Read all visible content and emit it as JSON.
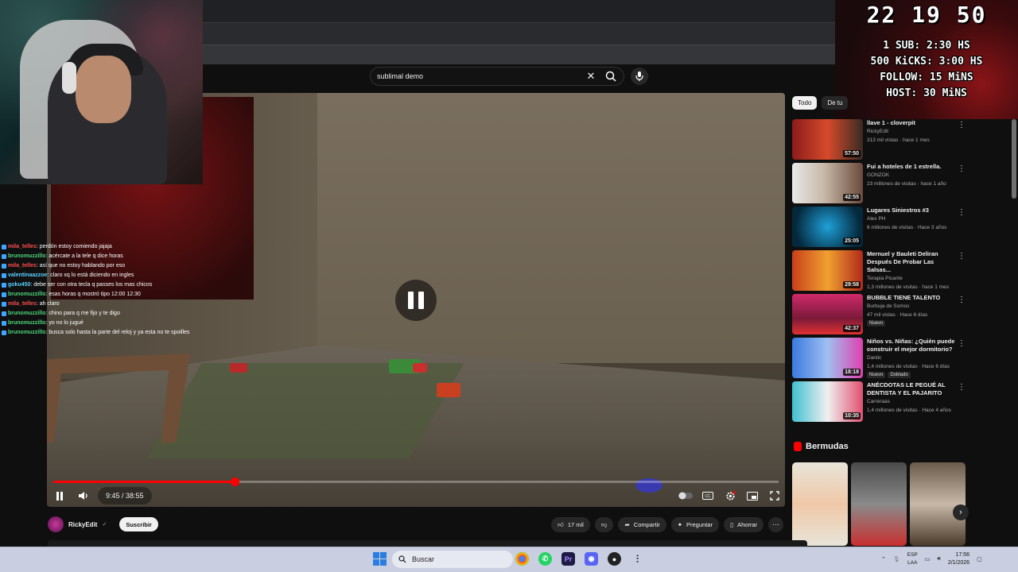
{
  "search": {
    "query": "sublimal demo"
  },
  "overlay": {
    "clock": "22 19 50",
    "goals": [
      "1 SUB: 2:30 HS",
      "500 KiCKS: 3:00 HS",
      "FOLLOW: 15 MiNS",
      "HOST: 30 MiNS"
    ]
  },
  "player": {
    "time": "9:45 / 38:55",
    "progress_fraction": 0.2505
  },
  "chat": [
    {
      "user": "mila_telles",
      "msg": ": perdón estoy comiendo jajaja",
      "color": "#ff4d4d"
    },
    {
      "user": "brunomuzzillo",
      "msg": ": acércate a la tele q dice horas",
      "color": "#4dd47a"
    },
    {
      "user": "mila_telles",
      "msg": ": así que no estoy hablando por eso",
      "color": "#ff4d4d"
    },
    {
      "user": "valentinaazzoe",
      "msg": ": claro xq lo está diciendo en ingles",
      "color": "#5ad1ff"
    },
    {
      "user": "goku450",
      "msg": ": debe ser con otra tecla q passes los mas chicos",
      "color": "#5ad1ff"
    },
    {
      "user": "brunomuzzillo",
      "msg": ": esas horas q mostró tipo 12:00 12:30",
      "color": "#4dd47a"
    },
    {
      "user": "mila_telles",
      "msg": ": ah claro",
      "color": "#ff4d4d"
    },
    {
      "user": "brunomuzzillo",
      "msg": ": chino para q me fijo y te digo",
      "color": "#4dd47a"
    },
    {
      "user": "brunomuzzillo",
      "msg": ": yo no lo jugué",
      "color": "#4dd47a"
    },
    {
      "user": "brunomuzzillo",
      "msg": ": busca solo hasta la parte del reloj y ya esta no te spoilles",
      "color": "#4dd47a"
    }
  ],
  "chips": [
    "Todo",
    "De tu"
  ],
  "recommendations": [
    {
      "title": "llave 1 - cloverpit",
      "channel": "RickyEdit",
      "meta": "313 mil vistas · hace 1 mes",
      "duration": "57:50",
      "badges": [],
      "thumb": "linear-gradient(90deg,#8a1b1b,#d64a2a 50%,#3a2a22)"
    },
    {
      "title": "Fui a hoteles de 1 estrella.",
      "channel": "GONZOK",
      "meta": "23 millones de visitas · hace 1 año",
      "duration": "42:55",
      "badges": [],
      "thumb": "linear-gradient(90deg,#e8e8e8,#c8b8a8 45%,#6a4a3a)"
    },
    {
      "title": "Lugares Siniestros #3",
      "channel": "Alex PH",
      "meta": "6 millones de visitas · Hace 3 años",
      "duration": "25:05",
      "badges": [],
      "thumb": "radial-gradient(circle at 50% 50%,#1fa0d8,#04283c 80%)"
    },
    {
      "title": "Mernuel y Bauleti Deliran Después De Probar Las Salsas...",
      "channel": "Terapia Picante",
      "meta": "1,3 millones de visitas · hace 1 mes",
      "duration": "29:58",
      "badges": [],
      "thumb": "linear-gradient(90deg,#c8401a,#f0a030 50%,#b02a1a)"
    },
    {
      "title": "BUBBLE TIENE TALENTO",
      "channel": "Burbuja de Somos",
      "meta": "47 mil vistas · Hace 6 días",
      "duration": "42:37",
      "badges": [
        "Nuevo"
      ],
      "thumb": "linear-gradient(180deg,#d02a6a,#7a1a3a 60%,#e03030)"
    },
    {
      "title": "Niños vs. Niñas: ¿Quién puede construir el mejor dormitorio?",
      "channel": "Dantic",
      "meta": "1,4 millones de visitas · Hace 6 días",
      "duration": "18:18",
      "badges": [
        "Nuevo",
        "Doblado"
      ],
      "thumb": "linear-gradient(90deg,#3a7ae0,#a0c0f0 50%,#e040b0)"
    },
    {
      "title": "ANÉCDOTAS LE PEGUÉ AL DENTISTA Y EL PAJARITO",
      "channel": "Carreraas",
      "meta": "1,4 millones de visitas · Hace 4 años",
      "duration": "10:35",
      "badges": [],
      "thumb": "linear-gradient(90deg,#40c0d0,#f0f0f0 50%,#e05070)"
    }
  ],
  "shorts": {
    "title": "Bermudas",
    "thumbs": [
      "linear-gradient(180deg,#e8e4d8,#f0c8a8 50%,#e8e4d8)",
      "linear-gradient(180deg,#4a4a4a,#8a8a8a 50%,#c83030)",
      "linear-gradient(180deg,#6a5a4a,#c8b8a8 50%,#4a3a2a)"
    ]
  },
  "channel": {
    "name": "RickyEdit",
    "subscribe": "Suscribir"
  },
  "actions": {
    "likes": "17 mil",
    "share": "Compartir",
    "ask": "Preguntar",
    "save": "Ahorrar"
  },
  "taskbar": {
    "search": "Buscar",
    "lang_top": "ESP",
    "lang_bottom": "LAA",
    "time": "17:56",
    "date": "2/1/2026"
  }
}
